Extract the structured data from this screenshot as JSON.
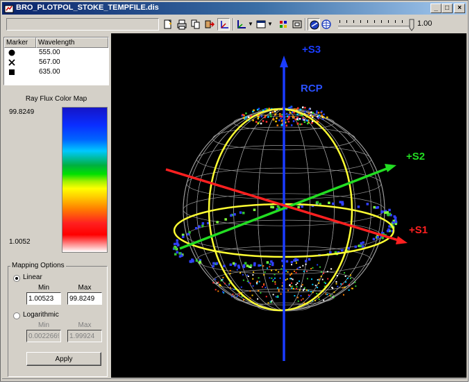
{
  "window": {
    "title": "BRO_PLOTPOL_STOKE_TEMPFILE.dis"
  },
  "titlebar_buttons": [
    "minimize-icon",
    "restore-icon",
    "close-icon"
  ],
  "toolbar": {
    "icons": [
      "new-window-icon",
      "print-icon",
      "copy-icon",
      "paste-icon",
      "rotate-axes-icon",
      "axes-icon",
      "window-icon",
      "palette-icon",
      "layer-icon",
      "sphere-icon",
      "globe-icon"
    ],
    "slider_value": "1.00"
  },
  "legend": {
    "headers": [
      "Marker",
      "Wavelength"
    ],
    "rows": [
      {
        "marker": "circle-marker-icon",
        "wavelength": "555.00"
      },
      {
        "marker": "cross-marker-icon",
        "wavelength": "567.00"
      },
      {
        "marker": "square-marker-icon",
        "wavelength": "635.00"
      }
    ]
  },
  "colormap": {
    "title": "Ray Flux Color Map",
    "max": "99.8249",
    "min": "1.0052"
  },
  "mapping": {
    "group_title": "Mapping Options",
    "linear_label": "Linear",
    "log_label": "Logarithmic",
    "min_label": "Min",
    "max_label": "Max",
    "linear_min": "1.00523",
    "linear_max": "99.8249",
    "log_min": "0.0022669",
    "log_max": "1.99924",
    "selected": "linear",
    "apply_label": "Apply"
  },
  "plot": {
    "labels": {
      "s3": "+S3",
      "rcp": "RCP",
      "s2": "+S2",
      "s1": "+S1"
    },
    "colors": {
      "s3": "#1a3cff",
      "s2": "#22dd22",
      "s1": "#ff2020",
      "rcp": "#2a50ff",
      "equator": "#ffff33",
      "wire": "#9a9a9a"
    }
  }
}
